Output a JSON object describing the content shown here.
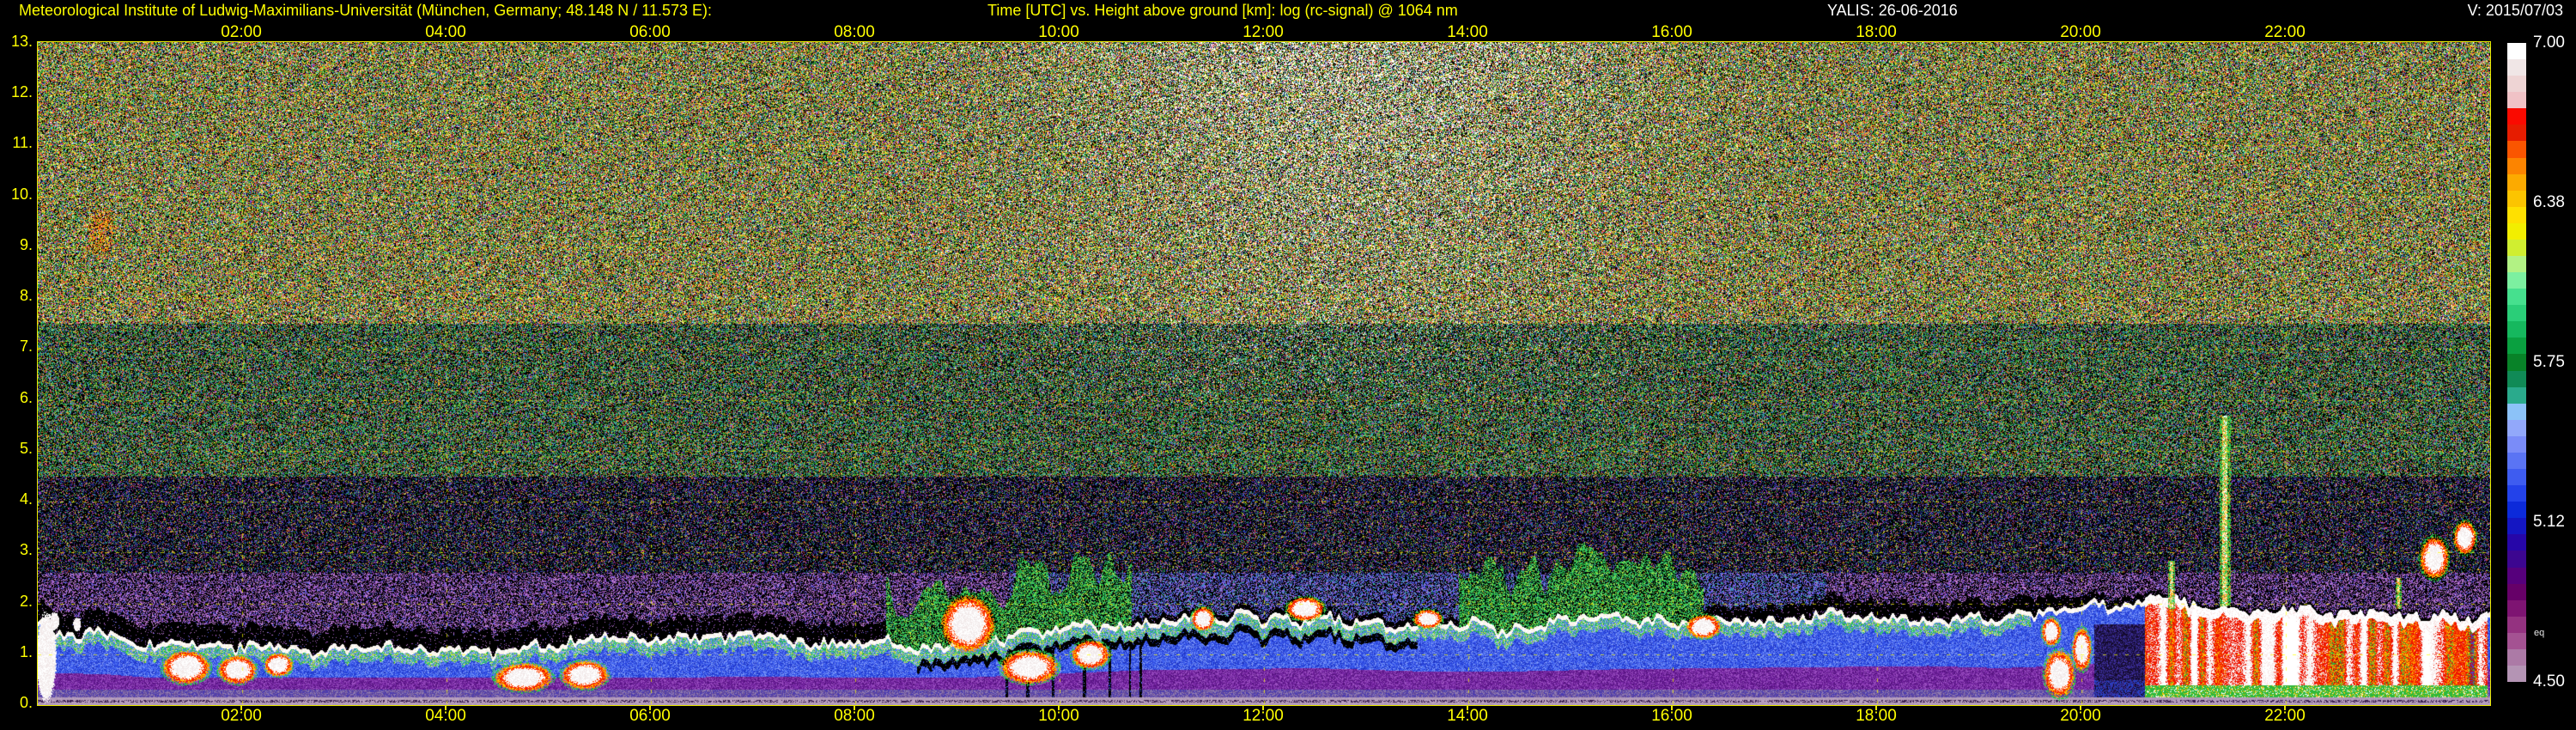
{
  "header": {
    "title_left": "Meteorological Institute of Ludwig-Maximilians-Universität (München, Germany; 48.148 N / 11.573 E):",
    "title_center": "Time [UTC] vs. Height above ground [km]: log (rc-signal) @ 1064 nm",
    "title_right": "YALIS: 26-06-2016",
    "version": "V: 2015/07/03"
  },
  "colors": {
    "background": "#000000",
    "axis_text": "#ffff00",
    "info_text": "#ffffff",
    "grid": "#ffff00",
    "border": "#e8e800"
  },
  "axes": {
    "x_ticks_top": [
      "02:00",
      "04:00",
      "06:00",
      "08:00",
      "10:00",
      "12:00",
      "14:00",
      "16:00",
      "18:00",
      "20:00",
      "22:00"
    ],
    "x_ticks_bottom": [
      "02:00",
      "04:00",
      "06:00",
      "08:00",
      "10:00",
      "12:00",
      "14:00",
      "16:00",
      "18:00",
      "20:00",
      "22:00"
    ],
    "x_tick_hours": [
      2,
      4,
      6,
      8,
      10,
      12,
      14,
      16,
      18,
      20,
      22
    ],
    "y_ticks": [
      "13.",
      "12.",
      "11.",
      "10.",
      "9.",
      "8.",
      "7.",
      "6.",
      "5.",
      "4.",
      "3.",
      "2.",
      "1.",
      "0."
    ],
    "y_tick_km": [
      13,
      12,
      11,
      10,
      9,
      8,
      7,
      6,
      5,
      4,
      3,
      2,
      1,
      0
    ]
  },
  "colorbar": {
    "ticks": [
      {
        "label": "7.00",
        "f": 0.0
      },
      {
        "label": "6.38",
        "f": 0.25
      },
      {
        "label": "5.75",
        "f": 0.5
      },
      {
        "label": "5.12",
        "f": 0.75
      },
      {
        "label": "4.50",
        "f": 1.0
      }
    ],
    "eq_label": "eq",
    "colors": [
      "#ffffff",
      "#f0e6e6",
      "#eed4d4",
      "#f0c2c6",
      "#fa0a00",
      "#e61c00",
      "#fa5500",
      "#fc8400",
      "#fcaa00",
      "#fcc400",
      "#ffe000",
      "#f2ee00",
      "#d0ee30",
      "#b2f284",
      "#7cf0a0",
      "#46e08e",
      "#2ace78",
      "#16b85e",
      "#0aa040",
      "#088228",
      "#108a56",
      "#2aaa8c",
      "#8cc2f8",
      "#92a8fa",
      "#7a8cf8",
      "#5a74f4",
      "#3e5cf0",
      "#2342ea",
      "#0c2ada",
      "#1416c2",
      "#2606a8",
      "#3c0690",
      "#56007c",
      "#660068",
      "#7e1472",
      "#943280",
      "#a45292",
      "#ac7aa6",
      "#b494b4"
    ]
  },
  "chart_data": {
    "type": "heatmap",
    "title": "Time [UTC] vs. Height above ground [km]: log (rc-signal) @ 1064 nm",
    "xlabel": "Time [UTC]",
    "ylabel": "Height above ground [km]",
    "instrument": "YALIS",
    "date": "26-06-2016",
    "wavelength_nm": 1064,
    "x_range_hours": [
      0,
      24
    ],
    "y_range_km": [
      0,
      13
    ],
    "scale": {
      "quantity": "log (rc-signal)",
      "min": 4.5,
      "max": 7.0,
      "tick_values": [
        7.0,
        6.38,
        5.75,
        5.12,
        4.5
      ]
    },
    "grid": {
      "x_step_hours": 2,
      "y_step_km": 1,
      "style": "dashed-yellow"
    },
    "boundary_layer_top_km": {
      "t": [
        0,
        0.7,
        1.1,
        1.6,
        2.3,
        3.0,
        3.8,
        5.0,
        6.0,
        7.0,
        8.0,
        8.6,
        9.3,
        10.0,
        10.8,
        11.5,
        12.5,
        13.5,
        14.5,
        15.5,
        16.5,
        17.5,
        18.5,
        19.2,
        19.8,
        20.3,
        21.0,
        21.8,
        22.5,
        23.2,
        24.0
      ],
      "h": [
        1.55,
        1.45,
        1.3,
        1.2,
        1.15,
        1.1,
        1.15,
        1.2,
        1.3,
        1.35,
        1.3,
        1.2,
        1.35,
        1.5,
        1.65,
        1.7,
        1.75,
        1.6,
        1.6,
        1.7,
        1.75,
        1.8,
        1.85,
        1.75,
        1.85,
        2.0,
        1.95,
        1.85,
        1.8,
        1.75,
        1.7
      ]
    },
    "black_band_km": {
      "t": [
        0,
        8,
        9.5,
        10.5,
        12,
        13.5,
        16.5,
        17.5,
        19.5,
        20.2,
        21,
        24
      ],
      "d": [
        0.38,
        0.35,
        0.2,
        0.12,
        0.1,
        0.12,
        0.22,
        0.3,
        0.3,
        0.15,
        0.1,
        0.1
      ]
    },
    "clouds": [
      [
        1.45,
        0.25,
        0.75,
        0.35
      ],
      [
        1.95,
        0.2,
        0.7,
        0.3
      ],
      [
        2.35,
        0.15,
        0.8,
        0.25
      ],
      [
        4.75,
        0.3,
        0.55,
        0.3
      ],
      [
        5.35,
        0.25,
        0.6,
        0.3
      ],
      [
        9.1,
        0.28,
        1.6,
        0.6
      ],
      [
        9.7,
        0.3,
        0.75,
        0.35
      ],
      [
        10.3,
        0.2,
        1.0,
        0.3
      ],
      [
        11.4,
        0.12,
        1.7,
        0.25
      ],
      [
        12.4,
        0.2,
        1.9,
        0.25
      ],
      [
        13.6,
        0.15,
        1.7,
        0.2
      ],
      [
        16.3,
        0.18,
        1.55,
        0.25
      ],
      [
        19.78,
        0.16,
        0.62,
        0.5
      ],
      [
        20.0,
        0.1,
        1.1,
        0.45
      ],
      [
        19.7,
        0.1,
        1.45,
        0.3
      ],
      [
        23.45,
        0.15,
        2.9,
        0.45
      ],
      [
        23.75,
        0.12,
        3.3,
        0.35
      ]
    ],
    "white_clouds": [
      [
        0.08,
        0.1,
        0.95,
        0.9
      ],
      [
        0.16,
        0.05,
        1.66,
        0.18
      ],
      [
        0.38,
        0.04,
        1.6,
        0.14
      ]
    ],
    "rain": {
      "t0": 20.62,
      "t1": 23.97,
      "base_km": 0.16,
      "green_fringe_top_km": 0.4
    },
    "dark_gap": {
      "t0": 20.12,
      "t1": 20.62,
      "h_top_km": 1.6
    },
    "spikes": [
      [
        21.4,
        0.055,
        1.95,
        5.7
      ],
      [
        20.88,
        0.035,
        1.9,
        2.85
      ],
      [
        23.1,
        0.03,
        1.9,
        2.5
      ]
    ],
    "precip_shafts": {
      "t0": 8.3,
      "t1": 11.3,
      "prob": 0.16
    },
    "plumes": {
      "ranges": [
        [
          8.3,
          10.7
        ],
        [
          13.9,
          16.3
        ]
      ],
      "height_km": 0.9
    },
    "cirrus_patch": {
      "t": 0.62,
      "dt": 0.14,
      "h_km": 9.3,
      "dh_km": 0.55
    },
    "daylight_noise": {
      "center_hour": 12.8,
      "sigma_hours": 2.6,
      "max_white_fraction": 0.32,
      "h_min_km": 5.5
    },
    "noise_zones": {
      "high": {
        "h_min": 7.5,
        "fill": 0.78,
        "colors": [
          "#3fae2e",
          "#3fae2e",
          "#2a7f1f",
          "#e8e23c",
          "#e8e23c",
          "#e2452a",
          "#e2452a",
          "#ef8a26",
          "#2f9f8d",
          "#3f55cf",
          "#c643c6",
          "#49c9c9",
          "#ffffff",
          "#e8e23c",
          "#3fae2e",
          "#ef8a26"
        ]
      },
      "mid": {
        "h_min": 4.5,
        "fill": 0.62,
        "colors": [
          "#35a432",
          "#35a432",
          "#35a432",
          "#2f9f8d",
          "#2f9f8d",
          "#1f7a1f",
          "#e0dc3a",
          "#44c4c4",
          "#3a55cc",
          "#d24632",
          "#ef8a26",
          "#b843b8"
        ]
      },
      "low": {
        "h_min": 2.6,
        "fill": 0.42,
        "colors": [
          "#3448c0",
          "#222c84",
          "#222c84",
          "#2f8f80",
          "#2f9f3f",
          "#7030a0",
          "#b843b8",
          "#d24632",
          "#d8d23a",
          "#3448c0"
        ]
      },
      "speckle_morning": {
        "fill": 0.5,
        "colors": [
          "#b06ec4",
          "#8a46b4",
          "#c890d8",
          "#5058e0",
          "#b06ec4",
          "#8a46b4"
        ]
      },
      "speckle_midday": {
        "fill": 0.55,
        "colors": [
          "#4a5ae4",
          "#6f60e8",
          "#8a6ad0",
          "#b070c8",
          "#4a5ae4",
          "#35b0a0"
        ]
      },
      "plume_colors": {
        "fill": 0.62,
        "colors": [
          "#2ec44e",
          "#2ec44e",
          "#57da62",
          "#1f9f38",
          "#c8e23c",
          "#35b08a"
        ]
      }
    },
    "bl_palette": {
      "line_white": [
        "#ffffff",
        "#ffffff",
        "#fdf4f0",
        "#f4ecda"
      ],
      "fringe": [
        "#1fae3c",
        "#2ecf5a",
        "#35b0a0",
        "#bfe8c8",
        "#d8e23c"
      ],
      "blue_zone": [
        "#2b46df",
        "#3a5aee",
        "#1f35c4",
        "#4f73f2",
        "#7d97f7"
      ],
      "purple_zone": [
        "#6b1d97",
        "#7e2fab",
        "#551380",
        "#9a4fc0"
      ],
      "transition": [
        "#8f7ab0",
        "#6a4f9a",
        "#4b3bb0"
      ],
      "ground_base": "#b49cbc",
      "ground_line": "#3a2050"
    },
    "cloud_palette": {
      "core": [
        "#ffffff",
        "#f2eaea"
      ],
      "rim_red": [
        "#f01800",
        "#ff4400"
      ],
      "rim_orange": [
        "#ff9100",
        "#ffd000"
      ],
      "edge_green": "#2cc44c"
    },
    "rain_palette": {
      "white": "#ffffff",
      "pink": "#f6e2e2",
      "red": "#ee1400",
      "dark_red": "#c01000",
      "orange": "#ff7300",
      "yellow": "#ffc400",
      "green": "#2db83c",
      "indigo": "#5540c0"
    },
    "gap_palette": [
      "#1a1040",
      "#2a2070",
      "#4030a0",
      "#120826",
      "#2244cc"
    ],
    "spike_palette": {
      "core": [
        "#ffffff",
        "#ffe04a"
      ],
      "mid": "#2ec84e",
      "edge": "#ff8820"
    },
    "cirrus_palette": [
      "#e2452a",
      "#ef8a26",
      "#ffc400"
    ]
  }
}
